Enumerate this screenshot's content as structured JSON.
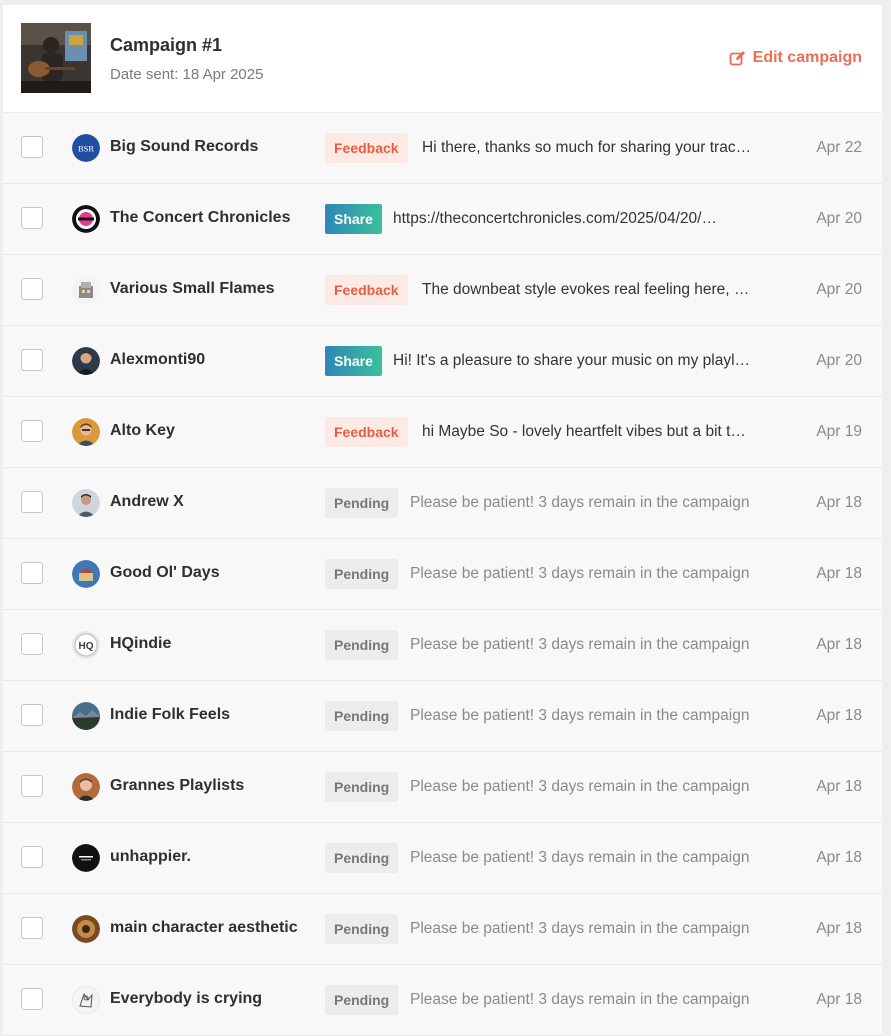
{
  "campaign": {
    "title": "Campaign #1",
    "date_sent": "Date sent: 18 Apr 2025",
    "edit_label": "Edit campaign",
    "accent_color": "#ee6d52"
  },
  "rows": [
    {
      "name": "Big Sound Records",
      "status": "Feedback",
      "message": "Hi there, thanks so much for sharing your trac…",
      "date": "Apr 22",
      "avatar_text": "BSR"
    },
    {
      "name": "The Concert Chronicles",
      "status": "Share",
      "message": "https://theconcertchronicles.com/2025/04/20/…",
      "date": "Apr 20"
    },
    {
      "name": "Various Small Flames",
      "status": "Feedback",
      "message": "The downbeat style evokes real feeling here, …",
      "date": "Apr 20"
    },
    {
      "name": "Alexmonti90",
      "status": "Share",
      "message": "Hi! It's a pleasure to share your music on my playl…",
      "date": "Apr 20"
    },
    {
      "name": "Alto Key",
      "status": "Feedback",
      "message": "hi Maybe So - lovely heartfelt vibes but a bit t…",
      "date": "Apr 19"
    },
    {
      "name": "Andrew X",
      "status": "Pending",
      "message": "Please be patient! 3 days remain in the campaign",
      "date": "Apr 18"
    },
    {
      "name": "Good Ol' Days",
      "status": "Pending",
      "message": "Please be patient! 3 days remain in the campaign",
      "date": "Apr 18"
    },
    {
      "name": "HQindie",
      "status": "Pending",
      "message": "Please be patient! 3 days remain in the campaign",
      "date": "Apr 18",
      "avatar_text": "HQ"
    },
    {
      "name": "Indie Folk Feels",
      "status": "Pending",
      "message": "Please be patient! 3 days remain in the campaign",
      "date": "Apr 18"
    },
    {
      "name": "Grannes Playlists",
      "status": "Pending",
      "message": "Please be patient! 3 days remain in the campaign",
      "date": "Apr 18"
    },
    {
      "name": "unhappier.",
      "status": "Pending",
      "message": "Please be patient! 3 days remain in the campaign",
      "date": "Apr 18"
    },
    {
      "name": "main character aesthetic",
      "status": "Pending",
      "message": "Please be patient! 3 days remain in the campaign",
      "date": "Apr 18"
    },
    {
      "name": "Everybody is crying",
      "status": "Pending",
      "message": "Please be patient! 3 days remain in the campaign",
      "date": "Apr 18"
    }
  ]
}
